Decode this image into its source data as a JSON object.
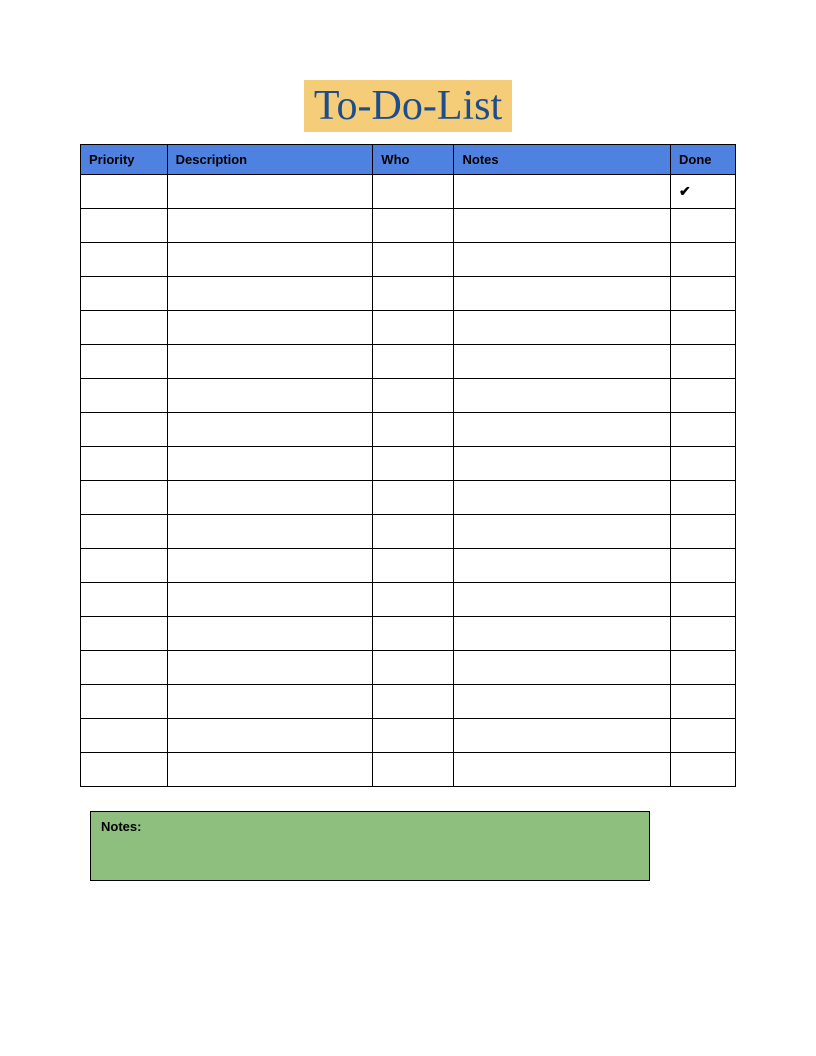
{
  "title": "To-Do-List",
  "columns": {
    "priority": "Priority",
    "description": "Description",
    "who": "Who",
    "notes": "Notes",
    "done": "Done"
  },
  "rows": [
    {
      "priority": "",
      "description": "",
      "who": "",
      "notes": "",
      "done": "✔"
    },
    {
      "priority": "",
      "description": "",
      "who": "",
      "notes": "",
      "done": ""
    },
    {
      "priority": "",
      "description": "",
      "who": "",
      "notes": "",
      "done": ""
    },
    {
      "priority": "",
      "description": "",
      "who": "",
      "notes": "",
      "done": ""
    },
    {
      "priority": "",
      "description": "",
      "who": "",
      "notes": "",
      "done": ""
    },
    {
      "priority": "",
      "description": "",
      "who": "",
      "notes": "",
      "done": ""
    },
    {
      "priority": "",
      "description": "",
      "who": "",
      "notes": "",
      "done": ""
    },
    {
      "priority": "",
      "description": "",
      "who": "",
      "notes": "",
      "done": ""
    },
    {
      "priority": "",
      "description": "",
      "who": "",
      "notes": "",
      "done": ""
    },
    {
      "priority": "",
      "description": "",
      "who": "",
      "notes": "",
      "done": ""
    },
    {
      "priority": "",
      "description": "",
      "who": "",
      "notes": "",
      "done": ""
    },
    {
      "priority": "",
      "description": "",
      "who": "",
      "notes": "",
      "done": ""
    },
    {
      "priority": "",
      "description": "",
      "who": "",
      "notes": "",
      "done": ""
    },
    {
      "priority": "",
      "description": "",
      "who": "",
      "notes": "",
      "done": ""
    },
    {
      "priority": "",
      "description": "",
      "who": "",
      "notes": "",
      "done": ""
    },
    {
      "priority": "",
      "description": "",
      "who": "",
      "notes": "",
      "done": ""
    },
    {
      "priority": "",
      "description": "",
      "who": "",
      "notes": "",
      "done": ""
    },
    {
      "priority": "",
      "description": "",
      "who": "",
      "notes": "",
      "done": ""
    }
  ],
  "notes_section": {
    "label": "Notes:",
    "content": ""
  },
  "colors": {
    "title_bg": "#f5cd79",
    "title_fg": "#1e4d8b",
    "header_bg": "#4f81e0",
    "notes_bg": "#8fbf7f"
  }
}
